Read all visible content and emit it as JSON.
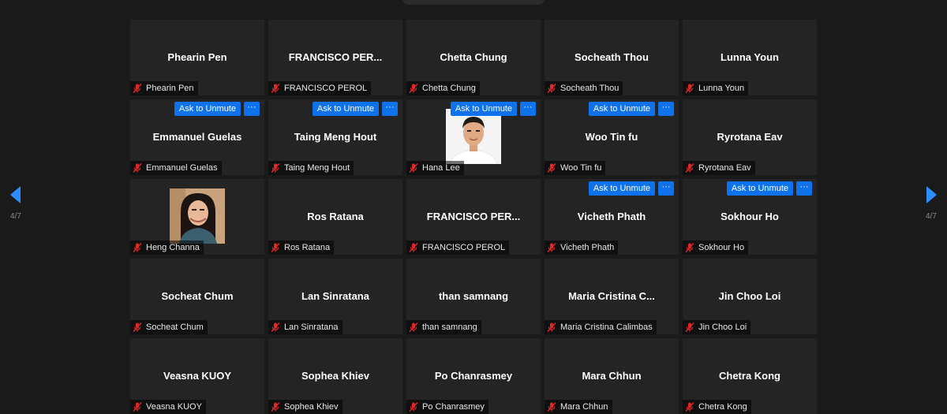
{
  "navigation": {
    "page_left": "4/7",
    "page_right": "4/7",
    "accent": "#2d8cff"
  },
  "controls": {
    "ask_to_unmute": "Ask to Unmute",
    "more": "···"
  },
  "participants": [
    {
      "display": "Phearin Pen",
      "tag": "Phearin Pen",
      "ask": false,
      "video": null
    },
    {
      "display": "FRANCISCO  PER...",
      "tag": "FRANCISCO PEROL",
      "ask": false,
      "video": null
    },
    {
      "display": "Chetta Chung",
      "tag": "Chetta Chung",
      "ask": false,
      "video": null
    },
    {
      "display": "Socheath Thou",
      "tag": "Socheath Thou",
      "ask": false,
      "video": null
    },
    {
      "display": "Lunna Youn",
      "tag": "Lunna Youn",
      "ask": false,
      "video": null
    },
    {
      "display": "Emmanuel Guelas",
      "tag": "Emmanuel Guelas",
      "ask": true,
      "video": null
    },
    {
      "display": "Taing Meng Hout",
      "tag": "Taing Meng Hout",
      "ask": true,
      "video": null
    },
    {
      "display": "",
      "tag": "Hana Lee",
      "ask": true,
      "video": "man"
    },
    {
      "display": "Woo Tin fu",
      "tag": "Woo Tin fu",
      "ask": true,
      "video": null
    },
    {
      "display": "Ryrotana Eav",
      "tag": "Ryrotana Eav",
      "ask": false,
      "video": null
    },
    {
      "display": "",
      "tag": "Heng Channa",
      "ask": false,
      "video": "woman"
    },
    {
      "display": "Ros Ratana",
      "tag": "Ros Ratana",
      "ask": false,
      "video": null
    },
    {
      "display": "FRANCISCO  PER...",
      "tag": "FRANCISCO PEROL",
      "ask": false,
      "video": null
    },
    {
      "display": "Vicheth Phath",
      "tag": "Vicheth Phath",
      "ask": true,
      "video": null
    },
    {
      "display": "Sokhour Ho",
      "tag": "Sokhour Ho",
      "ask": true,
      "video": null
    },
    {
      "display": "Socheat Chum",
      "tag": "Socheat Chum",
      "ask": false,
      "video": null
    },
    {
      "display": "Lan Sinratana",
      "tag": "Lan Sinratana",
      "ask": false,
      "video": null
    },
    {
      "display": "than samnang",
      "tag": "than samnang",
      "ask": false,
      "video": null
    },
    {
      "display": "Maria  Cristina  C...",
      "tag": "Maria Cristina Calimbas",
      "ask": false,
      "video": null
    },
    {
      "display": "Jin Choo Loi",
      "tag": "Jin Choo Loi",
      "ask": false,
      "video": null
    },
    {
      "display": "Veasna KUOY",
      "tag": "Veasna KUOY",
      "ask": false,
      "video": null
    },
    {
      "display": "Sophea Khiev",
      "tag": "Sophea Khiev",
      "ask": false,
      "video": null
    },
    {
      "display": "Po Chanrasmey",
      "tag": "Po Chanrasmey",
      "ask": false,
      "video": null
    },
    {
      "display": "Mara Chhun",
      "tag": "Mara Chhun",
      "ask": false,
      "video": null
    },
    {
      "display": "Chetra Kong",
      "tag": "Chetra Kong",
      "ask": false,
      "video": null
    }
  ]
}
